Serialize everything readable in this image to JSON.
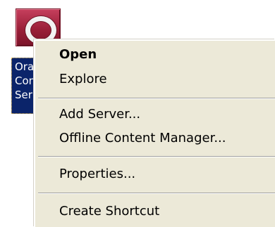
{
  "desktop_icon": {
    "label_lines": [
      "Ora",
      "Con",
      "Ser"
    ]
  },
  "context_menu": {
    "items": [
      {
        "label": "Open",
        "default": true
      },
      {
        "label": "Explore"
      },
      {
        "label": "Add Server..."
      },
      {
        "label": "Offline Content Manager..."
      },
      {
        "label": "Properties..."
      },
      {
        "label": "Create Shortcut"
      }
    ]
  },
  "colors": {
    "menu_bg": "#ece9d8",
    "selection_bg": "#0b246a",
    "icon_red": "#9a1f38"
  }
}
